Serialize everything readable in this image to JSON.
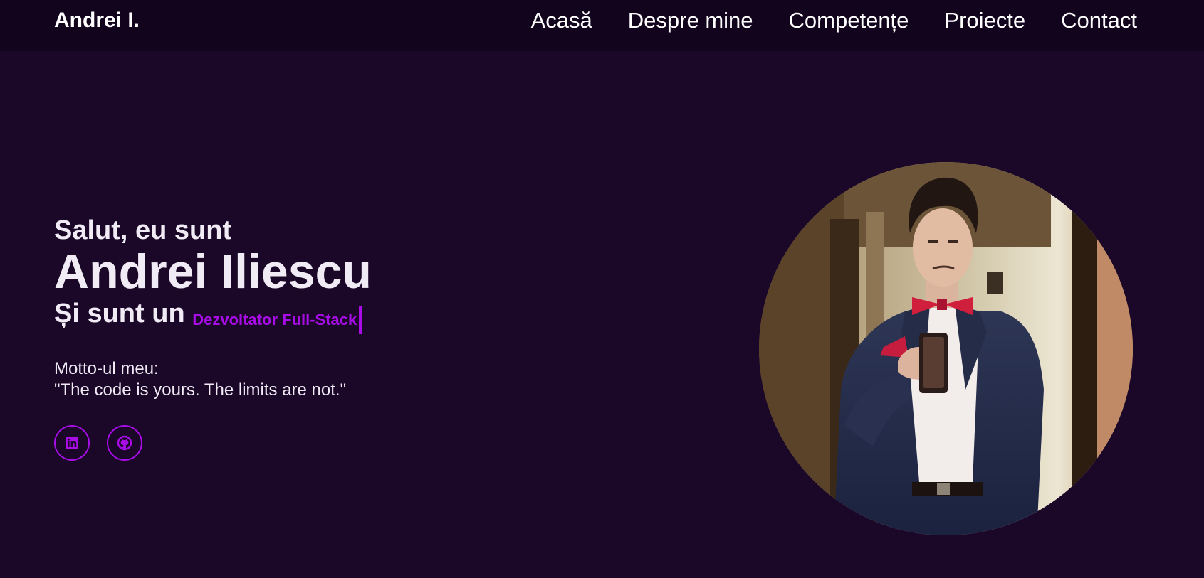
{
  "header": {
    "logo": "Andrei I.",
    "nav": [
      "Acasă",
      "Despre mine",
      "Competențe",
      "Proiecte",
      "Contact"
    ]
  },
  "hero": {
    "greeting": "Salut, eu sunt",
    "name": "Andrei Iliescu",
    "role_prefix": "Și sunt un",
    "role": "Dezvoltator Full-Stack",
    "motto_label": "Motto-ul meu:",
    "motto_quote": "\"The code is yours. The limits are not.\""
  },
  "social": [
    {
      "icon": "linkedin-icon"
    },
    {
      "icon": "github-icon"
    }
  ],
  "colors": {
    "background": "#1b0829",
    "header_background": "#13041d",
    "accent": "#a80de8",
    "text": "#f0ebf5"
  }
}
